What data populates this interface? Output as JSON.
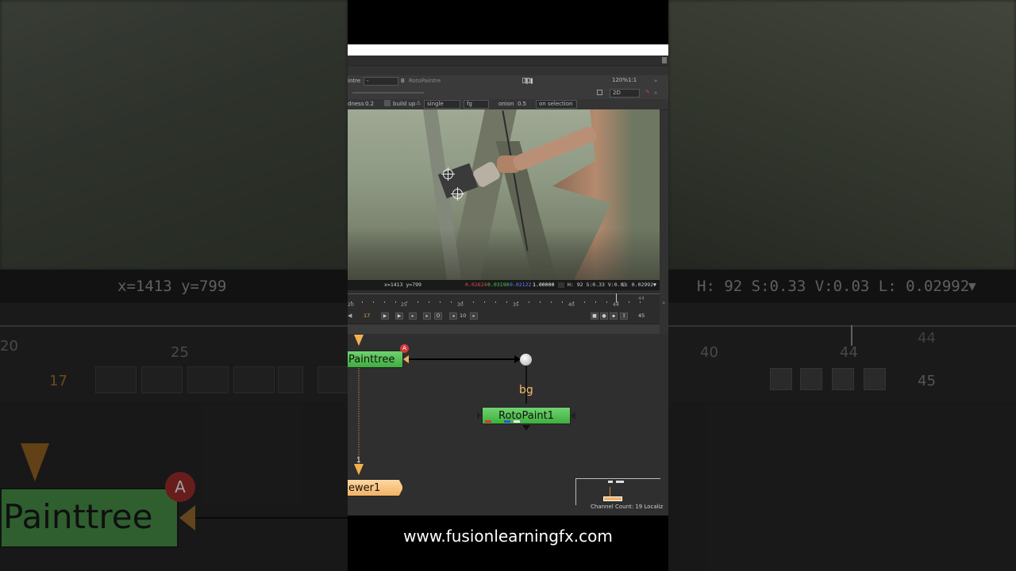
{
  "background": {
    "coords": "x=1413 y=799",
    "hsv": "H: 92 S:0.33 V:0.03  L: 0.02992",
    "left_timeline_labels": [
      "20",
      "25"
    ],
    "right_timeline_labels": [
      "40",
      "44"
    ],
    "right_frame_top": "44",
    "current_frame": "17",
    "end_frame": "45",
    "node_label": "Painttree",
    "node_badge": "A",
    "dropdown_glyph": "▼"
  },
  "toolbar1": {
    "node_a": "intre",
    "dash": "-",
    "b_label": "B",
    "node_b": "RotoPaintre",
    "zoom": "120%",
    "ratio": "1:1"
  },
  "toolbar2": {
    "view_mode": "2D"
  },
  "toolbar3": {
    "hardness_label": "dness",
    "hardness_value": "0.2",
    "buildup_label": "build up",
    "lifetime_mode": "single",
    "channel": "fg",
    "onion_label": "onion",
    "onion_value": "0.5",
    "onion_mode": "on selection"
  },
  "viewer_info": {
    "coords": "x=1413 y=799",
    "r": "0.02624",
    "g": "0.03190",
    "b": "0.02122",
    "a": "1.00000",
    "hsv": "H: 92 S:0.33 V:0.03",
    "luma": "L: 0.02992"
  },
  "timeline": {
    "labels": [
      "20",
      "25",
      "30",
      "35",
      "40",
      "44"
    ],
    "out_frame_top": "44",
    "current_frame": "17",
    "step": "10",
    "end_frame": "45"
  },
  "nodegraph": {
    "paint_node": "Painttree",
    "paint_badge": "A",
    "roto_node": "RotoPaint1",
    "bg_label": "bg",
    "viewer_node": "ewer1",
    "viewer_input": "1",
    "channel_count": "Channel Count: 19  Localiz"
  },
  "caption": "www.fusionlearningfx.com",
  "colors": {
    "node_green": "#4fc44f",
    "viewer_orange": "#f5b96f",
    "badge_red": "#d23a3a",
    "accent_orange": "#e8a64a"
  }
}
